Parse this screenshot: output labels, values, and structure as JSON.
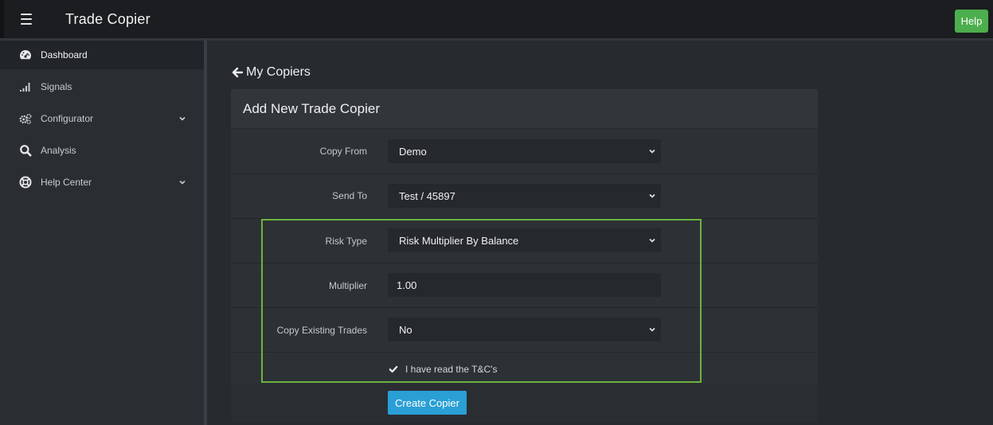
{
  "app": {
    "title": "Trade Copier",
    "help_label": "Help"
  },
  "sidebar": {
    "items": [
      {
        "label": "Dashboard",
        "icon": "dashboard-gauge-icon",
        "active": true
      },
      {
        "label": "Signals",
        "icon": "signal-bars-icon"
      },
      {
        "label": "Configurator",
        "icon": "gears-icon",
        "expandable": true
      },
      {
        "label": "Analysis",
        "icon": "search-icon"
      },
      {
        "label": "Help Center",
        "icon": "life-ring-icon",
        "expandable": true
      }
    ]
  },
  "main": {
    "back_label": "My Copiers",
    "panel_title": "Add New Trade Copier",
    "form": {
      "copy_from": {
        "label": "Copy From",
        "value": "Demo"
      },
      "send_to": {
        "label": "Send To",
        "value": "Test / 45897"
      },
      "risk_type": {
        "label": "Risk Type",
        "value": "Risk Multiplier By Balance"
      },
      "multiplier": {
        "label": "Multiplier",
        "value": "1.00"
      },
      "copy_existing": {
        "label": "Copy Existing Trades",
        "value": "No"
      },
      "terms": {
        "label": "I have read the T&C's",
        "checked": true
      }
    },
    "submit_label": "Create Copier"
  },
  "colors": {
    "accent_green": "#4cae4c",
    "primary_blue": "#2a9fd6",
    "highlight_border": "#6cb33f",
    "background": "#272b30"
  }
}
